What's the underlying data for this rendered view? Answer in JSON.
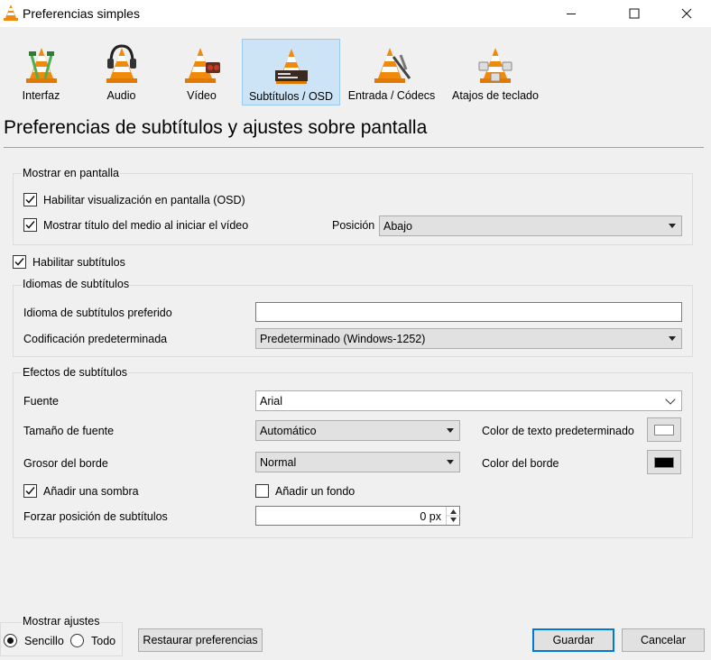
{
  "window": {
    "title": "Preferencias simples"
  },
  "categories": [
    {
      "label": "Interfaz",
      "icon": "interface-cone-icon"
    },
    {
      "label": "Audio",
      "icon": "audio-headphones-cone-icon"
    },
    {
      "label": "Vídeo",
      "icon": "video-cone-icon"
    },
    {
      "label": "Subtítulos / OSD",
      "icon": "subtitles-cone-icon",
      "active": true
    },
    {
      "label": "Entrada / Códecs",
      "icon": "input-codecs-cone-icon"
    },
    {
      "label": "Atajos de teclado",
      "icon": "hotkeys-cone-icon"
    }
  ],
  "page_title": "Preferencias de subtítulos y ajustes sobre pantalla",
  "osd": {
    "group_title": "Mostrar en pantalla",
    "enable_osd": {
      "label": "Habilitar visualización en pantalla (OSD)",
      "checked": true
    },
    "show_title": {
      "label": "Mostrar título del medio al iniciar el vídeo",
      "checked": true
    },
    "position_label": "Posición",
    "position_value": "Abajo"
  },
  "enable_subtitles": {
    "label": "Habilitar subtítulos",
    "checked": true
  },
  "languages": {
    "group_title": "Idiomas de subtítulos",
    "preferred_label": "Idioma de subtítulos preferido",
    "preferred_value": "",
    "encoding_label": "Codificación predeterminada",
    "encoding_value": "Predeterminado (Windows-1252)"
  },
  "effects": {
    "group_title": "Efectos de subtítulos",
    "font_label": "Fuente",
    "font_value": "Arial",
    "font_size_label": "Tamaño de fuente",
    "font_size_value": "Automático",
    "text_color_label": "Color de texto predeterminado",
    "text_color": "#ffffff",
    "border_label": "Grosor del borde",
    "border_value": "Normal",
    "border_color_label": "Color del borde",
    "border_color": "#000000",
    "shadow": {
      "label": "Añadir una sombra",
      "checked": true
    },
    "background": {
      "label": "Añadir un fondo",
      "checked": false
    },
    "force_position_label": "Forzar posición de subtítulos",
    "force_position_value": "0 px"
  },
  "footer": {
    "show_settings_title": "Mostrar ajustes",
    "simple_label": "Sencillo",
    "all_label": "Todo",
    "selected": "simple",
    "restore_label": "Restaurar preferencias",
    "save_label": "Guardar",
    "cancel_label": "Cancelar"
  },
  "colors": {
    "accent": "#0078d7",
    "active_tab_bg": "#cde4f7",
    "cone_orange": "#f08a0c"
  }
}
